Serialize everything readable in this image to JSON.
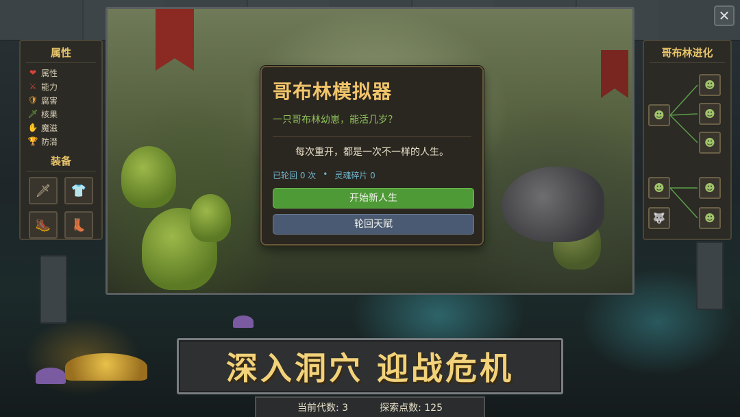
{
  "left_panel": {
    "attributes_title": "属性",
    "attributes": [
      {
        "label": "属性",
        "icon": "heart-icon",
        "glyph": "❤",
        "color": "#d8443a"
      },
      {
        "label": "能力",
        "icon": "sword-icon",
        "glyph": "⚔",
        "color": "#c84a3a"
      },
      {
        "label": "腐害",
        "icon": "shield-icon",
        "glyph": "🛡",
        "color": "#d89a3a"
      },
      {
        "label": "核果",
        "icon": "dagger-icon",
        "glyph": "🗡",
        "color": "#7ab84a"
      },
      {
        "label": "魔滋",
        "icon": "claw-icon",
        "glyph": "✋",
        "color": "#4a8ad8"
      },
      {
        "label": "防潸",
        "icon": "trophy-icon",
        "glyph": "🏆",
        "color": "#9aa0c8"
      }
    ],
    "equipment_title": "装备",
    "equipment": [
      {
        "icon": "sword-icon",
        "glyph": "🗡"
      },
      {
        "icon": "armor-icon",
        "glyph": "👕"
      },
      {
        "icon": "boot-icon",
        "glyph": "🥾"
      },
      {
        "icon": "boots-icon",
        "glyph": "👢"
      }
    ]
  },
  "right_panel": {
    "title": "哥布林进化"
  },
  "dialog": {
    "title": "哥布林模拟器",
    "subtitle": "一只哥布林幼崽，能活几岁？",
    "description": "每次重开，都是一次不一样的人生。",
    "reincarnation_count": "已轮回 0 次",
    "separator": "•",
    "soul_fragments": "灵魂碎片 0",
    "start_button": "开始新人生",
    "talent_button": "轮回天赋"
  },
  "tagline": "深入洞穴 迎战危机",
  "status": {
    "generation": "当前代数: 3",
    "exploration": "探索点数: 125"
  },
  "close_label": "✕",
  "colors": {
    "accent_gold": "#f0c46a",
    "accent_green": "#4d9a36",
    "accent_blue": "#4a5a72",
    "subtitle_green": "#8fc35a",
    "stats_blue": "#6fb3c9"
  }
}
